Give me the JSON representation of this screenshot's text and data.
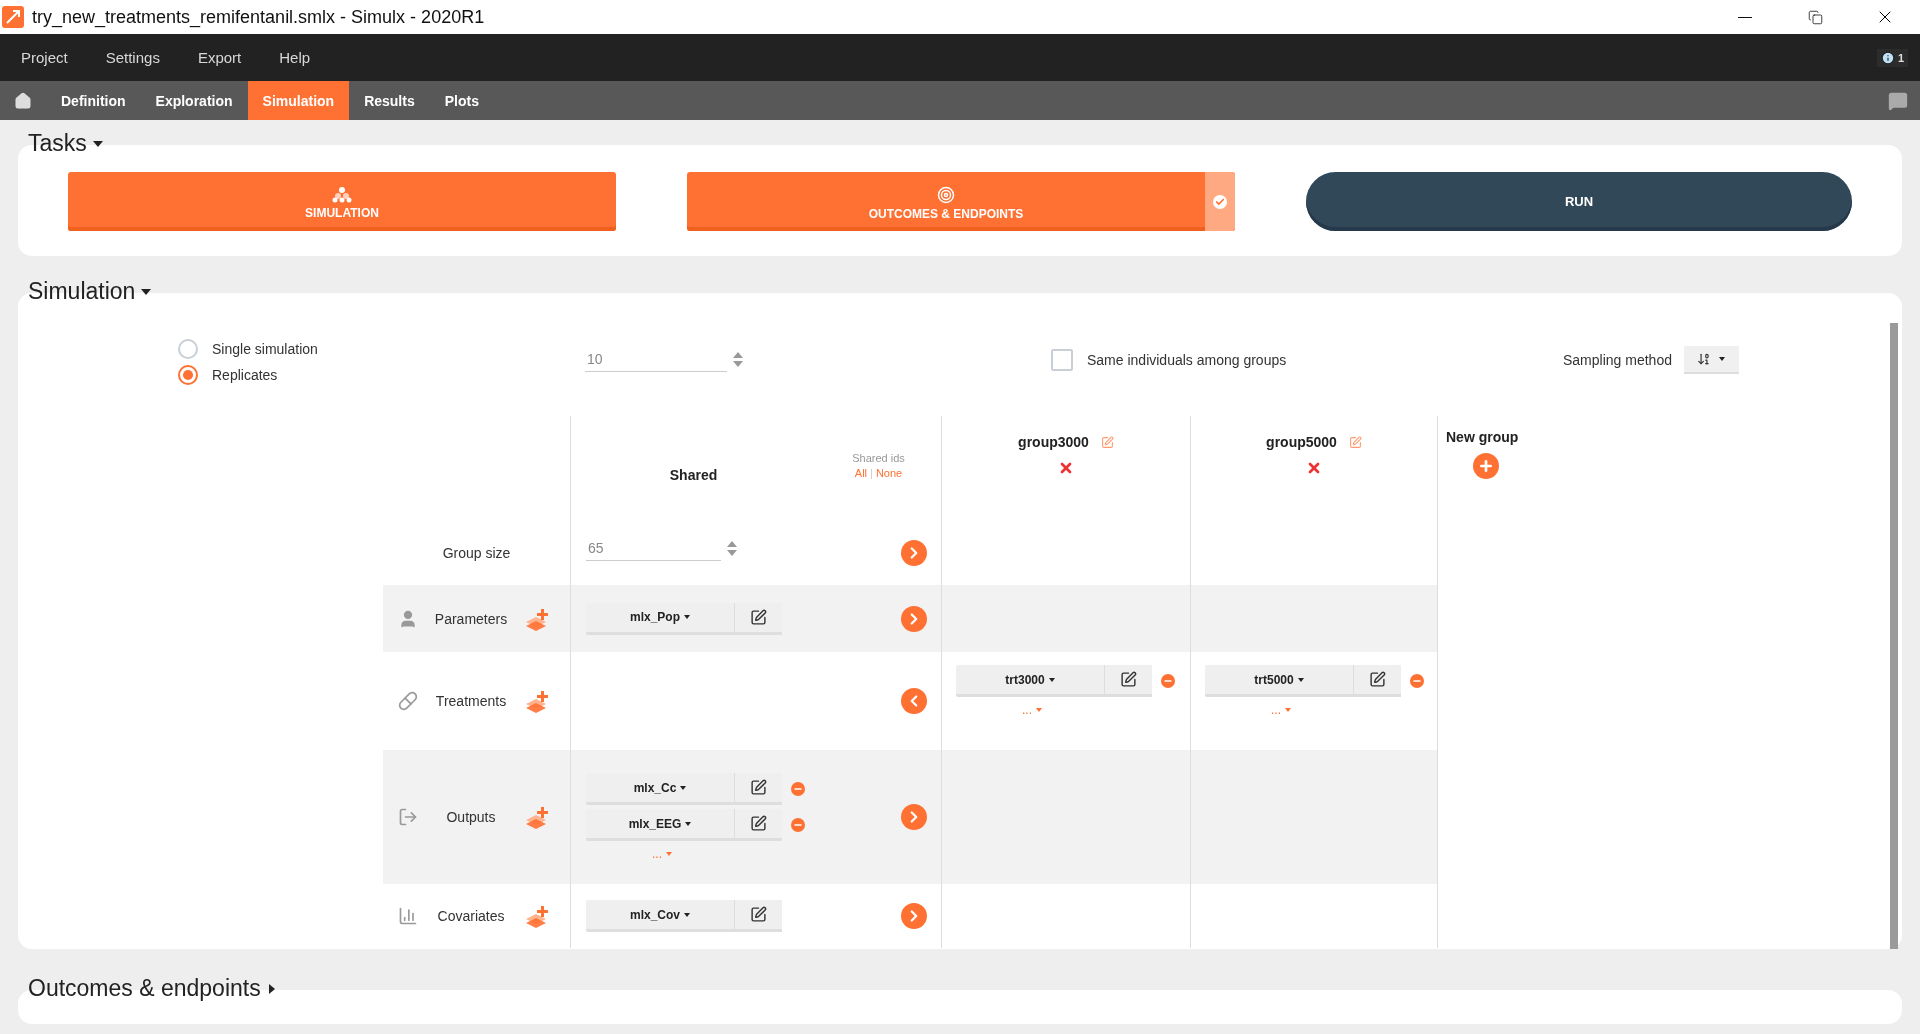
{
  "window": {
    "title": "try_new_treatments_remifentanil.smlx - Simulx - 2020R1"
  },
  "menu": [
    "Project",
    "Settings",
    "Export",
    "Help"
  ],
  "notifications": {
    "count": "1"
  },
  "nav_tabs": [
    {
      "label": "Definition",
      "selected": false
    },
    {
      "label": "Exploration",
      "selected": false
    },
    {
      "label": "Simulation",
      "selected": true
    },
    {
      "label": "Results",
      "selected": false
    },
    {
      "label": "Plots",
      "selected": false
    }
  ],
  "tasks": {
    "title": "Tasks",
    "expanded": true,
    "buttons": [
      {
        "label": "SIMULATION",
        "kind": "simulation",
        "checked": false
      },
      {
        "label": "OUTCOMES & ENDPOINTS",
        "kind": "outcomes",
        "checked": true
      },
      {
        "label": "RUN",
        "kind": "run"
      }
    ]
  },
  "simulation": {
    "title": "Simulation",
    "expanded": true,
    "modes": [
      {
        "label": "Single simulation",
        "selected": false
      },
      {
        "label": "Replicates",
        "selected": true
      }
    ],
    "replicates": "10",
    "same_individuals": {
      "label": "Same individuals among groups",
      "checked": false
    },
    "sampling_method": {
      "label": "Sampling method"
    }
  },
  "grid": {
    "shared": {
      "title": "Shared",
      "shared_ids_label": "Shared ids",
      "shared_ids_links": [
        "All",
        "None"
      ],
      "shared_ids_separator": "|"
    },
    "groups": [
      {
        "name": "group3000"
      },
      {
        "name": "group5000"
      }
    ],
    "new_group": "New group",
    "group_size": {
      "label": "Group size",
      "value": "65",
      "arrow": {
        "kind": "right"
      }
    },
    "rows": [
      {
        "label": "Parameters",
        "kind": "parameters",
        "arrow": {
          "kind": "right"
        },
        "shared": {
          "items": [
            {
              "name": "mlx_Pop",
              "removable": false
            }
          ]
        }
      },
      {
        "label": "Treatments",
        "kind": "treatments",
        "arrow": {
          "kind": "left"
        },
        "groups": [
          {
            "items": [
              {
                "name": "trt3000",
                "removable": true
              }
            ],
            "more": "..."
          },
          {
            "items": [
              {
                "name": "trt5000",
                "removable": true
              }
            ],
            "more": "..."
          }
        ]
      },
      {
        "label": "Outputs",
        "kind": "outputs",
        "arrow": {
          "kind": "right"
        },
        "shared": {
          "items": [
            {
              "name": "mlx_Cc",
              "removable": true
            },
            {
              "name": "mlx_EEG",
              "removable": true
            }
          ],
          "more": "..."
        }
      },
      {
        "label": "Covariates",
        "kind": "covariates",
        "arrow": {
          "kind": "right"
        },
        "shared": {
          "items": [
            {
              "name": "mlx_Cov",
              "removable": false
            }
          ]
        }
      }
    ]
  },
  "outcomes": {
    "title": "Outcomes & endpoints",
    "expanded": false
  }
}
